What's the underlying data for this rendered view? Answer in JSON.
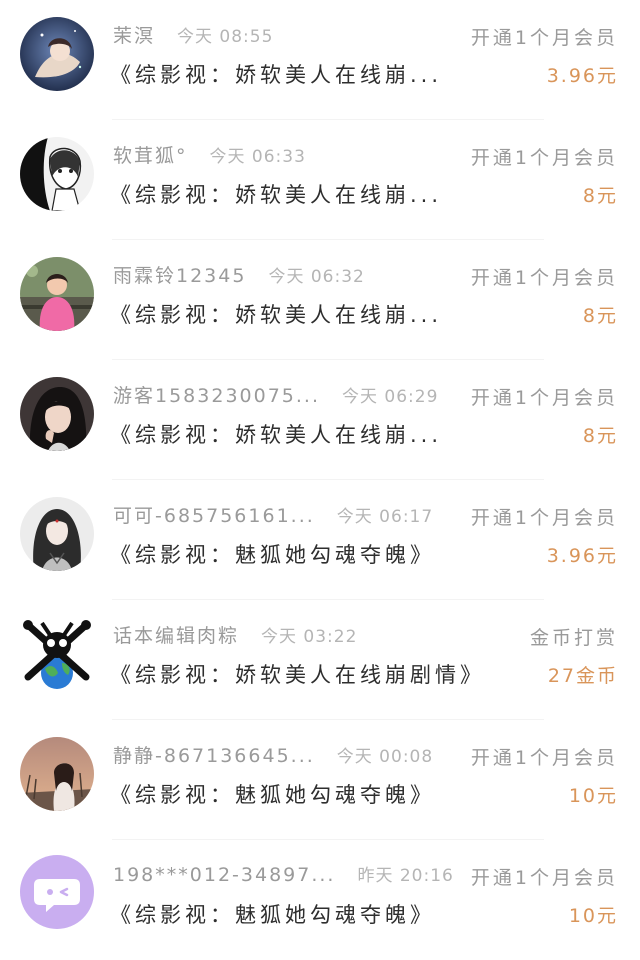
{
  "colors": {
    "name": "#9a9a9a",
    "time": "#b5b5b5",
    "title": "#2e2e2e",
    "type": "#9a9a9a",
    "amount": "#d9955a",
    "divider": "#f3f3f3"
  },
  "items": [
    {
      "name": "茉溟",
      "time": "今天 08:55",
      "title": "《综影视：娇软美人在线崩...",
      "type": "开通1个月会员",
      "amount": "3.96元",
      "avatar_icon": "avatar-anime-girl-night-icon"
    },
    {
      "name": "软茸狐°",
      "time": "今天 06:33",
      "title": "《综影视：娇软美人在线崩...",
      "type": "开通1个月会员",
      "amount": "8元",
      "avatar_icon": "avatar-manga-girl-icon"
    },
    {
      "name": "雨霖铃12345",
      "time": "今天 06:32",
      "title": "《综影视：娇软美人在线崩...",
      "type": "开通1个月会员",
      "amount": "8元",
      "avatar_icon": "avatar-child-pink-jacket-icon"
    },
    {
      "name": "游客1583230075...",
      "time": "今天 06:29",
      "title": "《综影视：娇软美人在线崩...",
      "type": "开通1个月会员",
      "amount": "8元",
      "avatar_icon": "avatar-woman-selfie-icon"
    },
    {
      "name": "可可-685756161...",
      "time": "今天 06:17",
      "title": "《综影视：魅狐她勾魂夺魄》",
      "type": "开通1个月会员",
      "amount": "3.96元",
      "avatar_icon": "avatar-ancient-costume-icon"
    },
    {
      "name": "话本编辑肉粽",
      "time": "今天 03:22",
      "title": "《综影视：娇软美人在线崩剧情》",
      "type": "金币打赏",
      "amount": "27金币",
      "avatar_icon": "avatar-earth-skull-icon"
    },
    {
      "name": "静静-867136645...",
      "time": "今天 00:08",
      "title": "《综影视：魅狐她勾魂夺魄》",
      "type": "开通1个月会员",
      "amount": "10元",
      "avatar_icon": "avatar-sunset-girl-icon"
    },
    {
      "name": "198***012-34897...",
      "time": "昨天 20:16",
      "title": "《综影视：魅狐她勾魂夺魄》",
      "type": "开通1个月会员",
      "amount": "10元",
      "avatar_icon": "avatar-chat-bubble-icon"
    }
  ]
}
